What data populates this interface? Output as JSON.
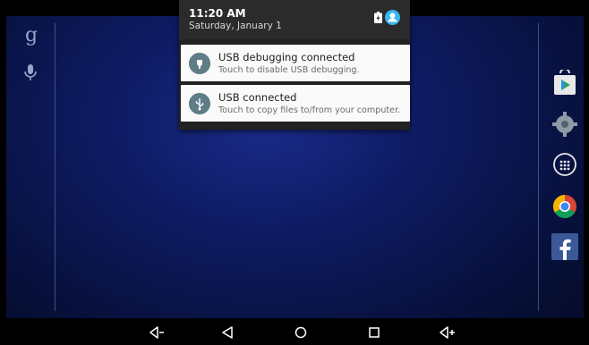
{
  "statusbar": {
    "time": "11:20 AM",
    "date": "Saturday, January 1",
    "icons": [
      "battery-icon",
      "account-icon"
    ]
  },
  "home": {
    "search_icon": "google-g-icon",
    "mic_icon": "mic-icon",
    "dock": [
      "play-store-icon",
      "settings-icon",
      "apps-drawer-icon",
      "chrome-icon",
      "facebook-icon"
    ]
  },
  "notifications": [
    {
      "title": "USB debugging connected",
      "text": "Touch to disable USB debugging.",
      "icon": "adb-icon"
    },
    {
      "title": "USB connected",
      "text": "Touch to copy files to/from your computer.",
      "icon": "usb-icon"
    }
  ],
  "navbar": {
    "buttons": [
      "volume-down-icon",
      "back-icon",
      "home-icon",
      "recents-icon",
      "volume-up-icon"
    ]
  },
  "colors": {
    "notif_icon_bg": "#5f7c87",
    "wallpaper": "#0e1b63"
  }
}
